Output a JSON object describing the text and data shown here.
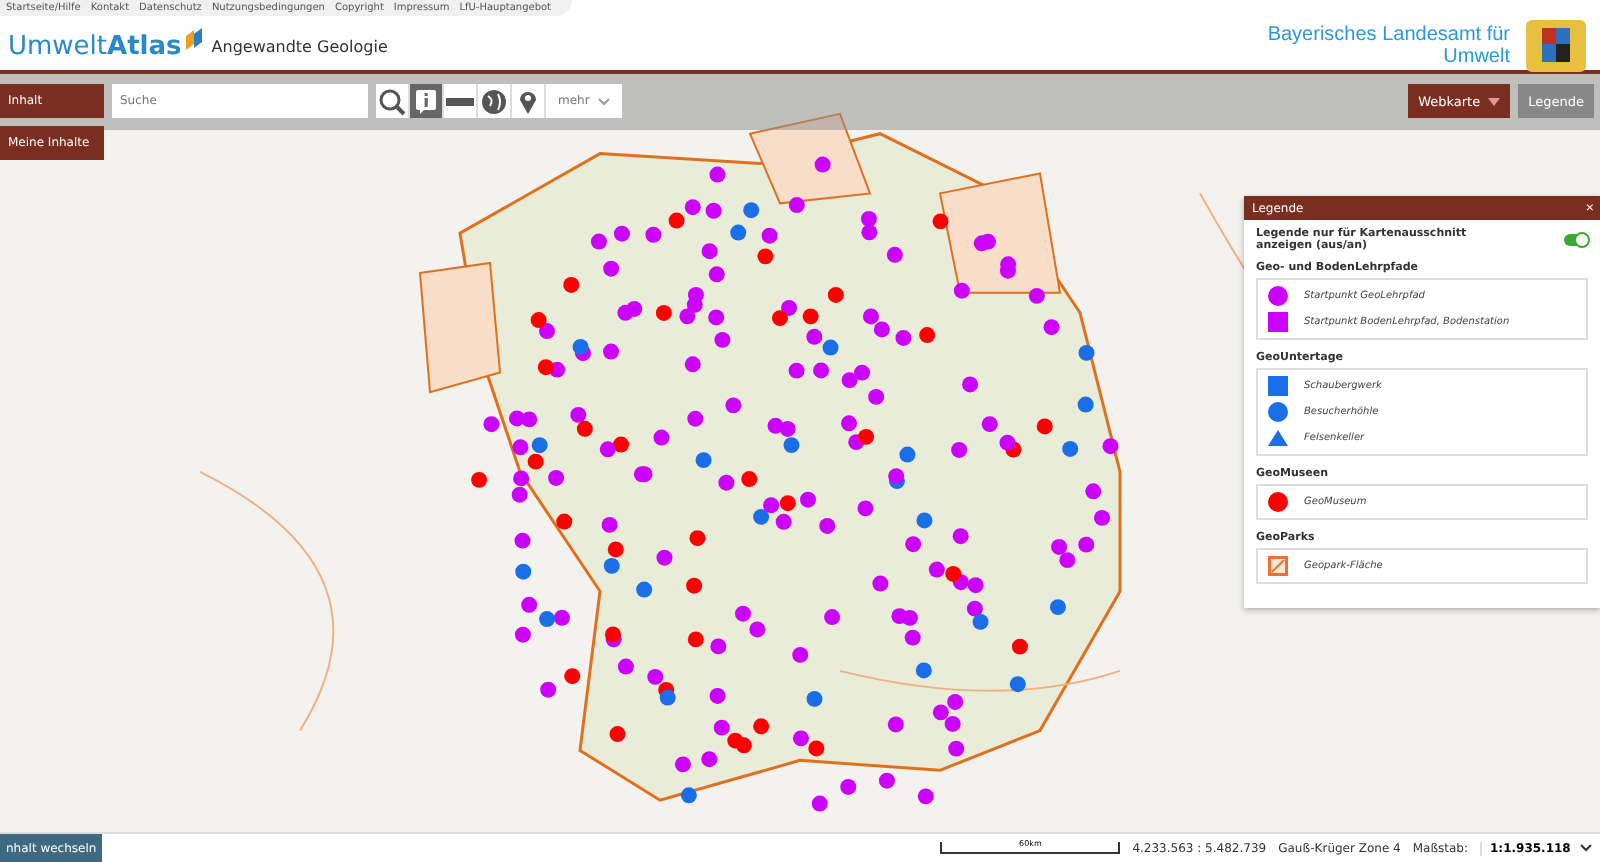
{
  "top_links": [
    "Startseite/Hilfe",
    "Kontakt",
    "Datenschutz",
    "Nutzungsbedingungen",
    "Copyright",
    "Impressum",
    "LfU-Hauptangebot"
  ],
  "logo": {
    "brand_light": "Umwelt",
    "brand_bold": "Atlas",
    "subtitle": "Angewandte Geologie"
  },
  "agency": {
    "line_1": "Bayerisches Landesamt für",
    "line_2": "Umwelt"
  },
  "side_buttons": [
    "Inhalt",
    "Meine Inhalte"
  ],
  "search": {
    "placeholder": "Suche"
  },
  "tools": [
    {
      "kind": "zoom",
      "selected": false
    },
    {
      "kind": "info",
      "selected": true
    },
    {
      "kind": "measure",
      "selected": false
    },
    {
      "kind": "globe",
      "selected": false
    },
    {
      "kind": "pin",
      "selected": false
    }
  ],
  "more_menu": "mehr",
  "right_buttons": [
    {
      "label": "Webkarte",
      "kind": "dropdown"
    },
    {
      "label": "Legende",
      "kind": "plain"
    }
  ],
  "legend": {
    "title": "Legende",
    "close": "×",
    "toggle": {
      "label": "Legende nur für Kartenausschnitt anzeigen (aus/an)",
      "on": true
    },
    "groups": [
      {
        "title": "Geo- und BodenLehrpfade",
        "items": [
          {
            "kind": "circle",
            "color": "#cc00ff",
            "label": "Startpunkt GeoLehrpfad"
          },
          {
            "kind": "square",
            "color": "#cc00ff",
            "label": "Startpunkt BodenLehrpfad, Bodenstation"
          }
        ]
      },
      {
        "title": "GeoUntertage",
        "items": [
          {
            "kind": "square",
            "color": "#1a6fe8",
            "label": "Schaubergwerk"
          },
          {
            "kind": "circle",
            "color": "#1a6fe8",
            "label": "Besucherhöhle"
          },
          {
            "kind": "triangle",
            "color": "#1a6fe8",
            "label": "Felsenkeller"
          }
        ]
      },
      {
        "title": "GeoMuseen",
        "items": [
          {
            "kind": "circle",
            "color": "#ff0000",
            "label": "GeoMuseum"
          }
        ]
      },
      {
        "title": "GeoParks",
        "items": [
          {
            "kind": "hatch",
            "color": "#f07030",
            "label": "Geopark-Fläche"
          }
        ]
      }
    ]
  },
  "status_bar": {
    "switch_button": "nhalt wechseln",
    "scale_label": "60km",
    "coordinates": "4.233.563 : 5.482.739",
    "projection": "Gauß-Krüger Zone 4",
    "scale_caption": "Maßstab:",
    "scale_value": "1:1.935.118"
  }
}
